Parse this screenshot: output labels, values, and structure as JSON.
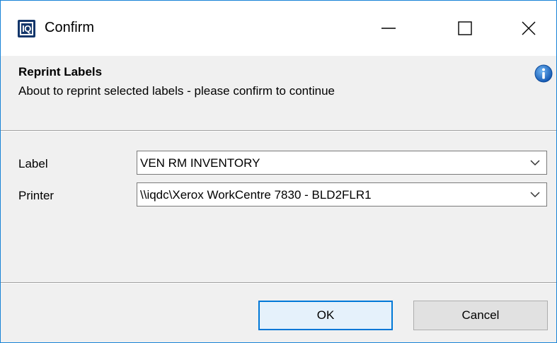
{
  "window": {
    "logo_text": "IQ",
    "title": "Confirm"
  },
  "info": {
    "heading": "Reprint Labels",
    "message": "About to reprint selected labels - please confirm to continue",
    "icon": "info-icon"
  },
  "form": {
    "label_field": {
      "label": "Label",
      "value": "VEN RM INVENTORY"
    },
    "printer_field": {
      "label": "Printer",
      "value": "\\\\iqdc\\Xerox WorkCentre 7830 - BLD2FLR1"
    }
  },
  "buttons": {
    "ok": "OK",
    "cancel": "Cancel"
  },
  "colors": {
    "window_border": "#1883d7",
    "info_icon": "#1a73c9",
    "ok_border": "#0078d7",
    "logo_bg": "#13366b"
  }
}
